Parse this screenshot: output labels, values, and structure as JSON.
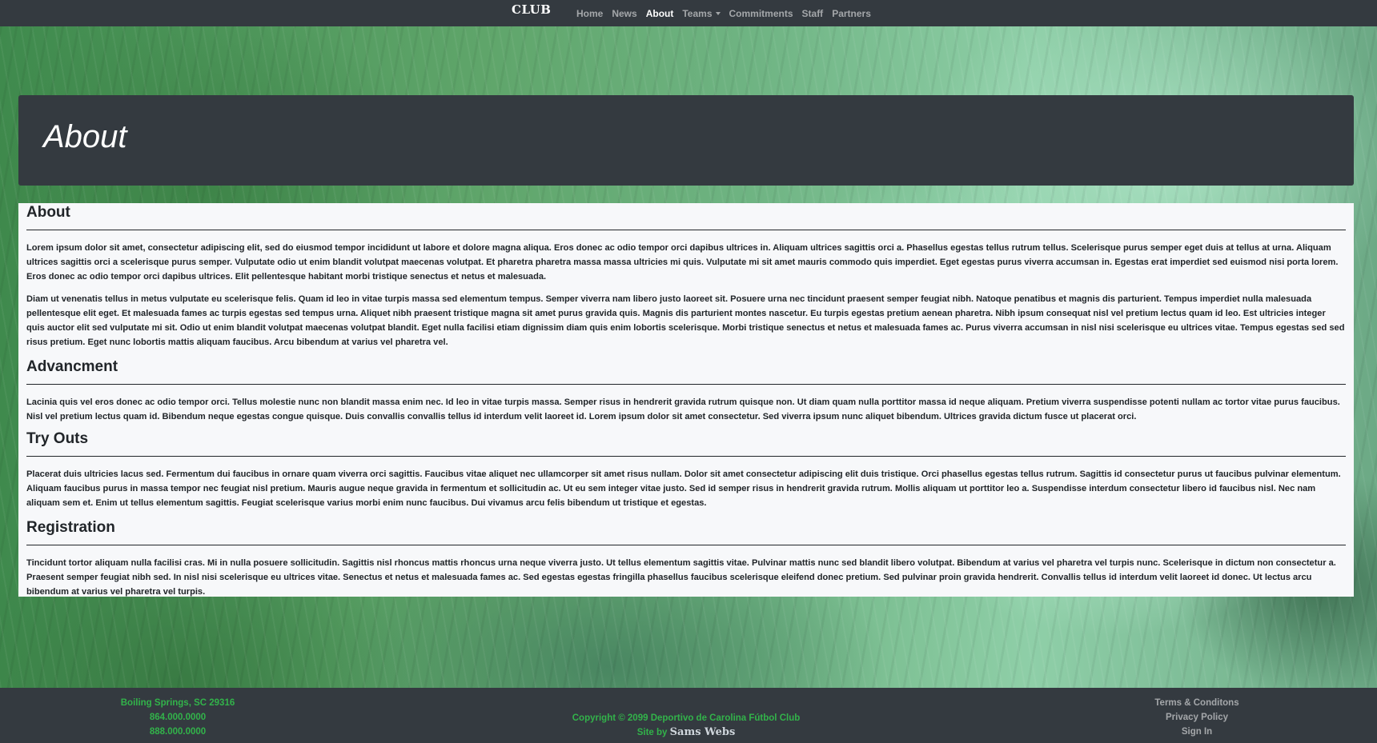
{
  "navbar": {
    "brand": "CLUB",
    "items": [
      {
        "label": "Home",
        "active": false
      },
      {
        "label": "News",
        "active": false
      },
      {
        "label": "About",
        "active": true
      },
      {
        "label": "Teams",
        "active": false,
        "dropdown": true
      },
      {
        "label": "Commitments",
        "active": false
      },
      {
        "label": "Staff",
        "active": false
      },
      {
        "label": "Partners",
        "active": false
      }
    ]
  },
  "jumbotron": {
    "title": "About"
  },
  "sections": [
    {
      "heading": "About",
      "paragraphs": [
        "Lorem ipsum dolor sit amet, consectetur adipiscing elit, sed do eiusmod tempor incididunt ut labore et dolore magna aliqua. Eros donec ac odio tempor orci dapibus ultrices in. Aliquam ultrices sagittis orci a. Phasellus egestas tellus rutrum tellus. Scelerisque purus semper eget duis at tellus at urna. Aliquam ultrices sagittis orci a scelerisque purus semper. Vulputate odio ut enim blandit volutpat maecenas volutpat. Et pharetra pharetra massa massa ultricies mi quis. Vulputate mi sit amet mauris commodo quis imperdiet. Eget egestas purus viverra accumsan in. Egestas erat imperdiet sed euismod nisi porta lorem. Eros donec ac odio tempor orci dapibus ultrices. Elit pellentesque habitant morbi tristique senectus et netus et malesuada.",
        "Diam ut venenatis tellus in metus vulputate eu scelerisque felis. Quam id leo in vitae turpis massa sed elementum tempus. Semper viverra nam libero justo laoreet sit. Posuere urna nec tincidunt praesent semper feugiat nibh. Natoque penatibus et magnis dis parturient. Tempus imperdiet nulla malesuada pellentesque elit eget. Et malesuada fames ac turpis egestas sed tempus urna. Aliquet nibh praesent tristique magna sit amet purus gravida quis. Magnis dis parturient montes nascetur. Eu turpis egestas pretium aenean pharetra. Nibh ipsum consequat nisl vel pretium lectus quam id leo. Est ultricies integer quis auctor elit sed vulputate mi sit. Odio ut enim blandit volutpat maecenas volutpat blandit. Eget nulla facilisi etiam dignissim diam quis enim lobortis scelerisque. Morbi tristique senectus et netus et malesuada fames ac. Purus viverra accumsan in nisl nisi scelerisque eu ultrices vitae. Tempus egestas sed sed risus pretium. Eget nunc lobortis mattis aliquam faucibus. Arcu bibendum at varius vel pharetra vel."
      ]
    },
    {
      "heading": "Advancment",
      "paragraphs": [
        "Lacinia quis vel eros donec ac odio tempor orci. Tellus molestie nunc non blandit massa enim nec. Id leo in vitae turpis massa. Semper risus in hendrerit gravida rutrum quisque non. Ut diam quam nulla porttitor massa id neque aliquam. Pretium viverra suspendisse potenti nullam ac tortor vitae purus faucibus. Nisl vel pretium lectus quam id. Bibendum neque egestas congue quisque. Duis convallis convallis tellus id interdum velit laoreet id. Lorem ipsum dolor sit amet consectetur. Sed viverra ipsum nunc aliquet bibendum. Ultrices gravida dictum fusce ut placerat orci."
      ]
    },
    {
      "heading": "Try Outs",
      "paragraphs": [
        "Placerat duis ultricies lacus sed. Fermentum dui faucibus in ornare quam viverra orci sagittis. Faucibus vitae aliquet nec ullamcorper sit amet risus nullam. Dolor sit amet consectetur adipiscing elit duis tristique. Orci phasellus egestas tellus rutrum. Sagittis id consectetur purus ut faucibus pulvinar elementum. Aliquam faucibus purus in massa tempor nec feugiat nisl pretium. Mauris augue neque gravida in fermentum et sollicitudin ac. Ut eu sem integer vitae justo. Sed id semper risus in hendrerit gravida rutrum. Mollis aliquam ut porttitor leo a. Suspendisse interdum consectetur libero id faucibus nisl. Nec nam aliquam sem et. Enim ut tellus elementum sagittis. Feugiat scelerisque varius morbi enim nunc faucibus. Dui vivamus arcu felis bibendum ut tristique et egestas."
      ]
    },
    {
      "heading": "Registration",
      "paragraphs": [
        "Tincidunt tortor aliquam nulla facilisi cras. Mi in nulla posuere sollicitudin. Sagittis nisl rhoncus mattis rhoncus urna neque viverra justo. Ut tellus elementum sagittis vitae. Pulvinar mattis nunc sed blandit libero volutpat. Bibendum at varius vel pharetra vel turpis nunc. Scelerisque in dictum non consectetur a. Praesent semper feugiat nibh sed. In nisl nisi scelerisque eu ultrices vitae. Senectus et netus et malesuada fames ac. Sed egestas egestas fringilla phasellus faucibus scelerisque eleifend donec pretium. Sed pulvinar proin gravida hendrerit. Convallis tellus id interdum velit laoreet id donec. Ut lectus arcu bibendum at varius vel pharetra vel turpis."
      ]
    }
  ],
  "footer": {
    "address": "Boiling Springs, SC 29316",
    "phone1": "864.000.0000",
    "phone2": "888.000.0000",
    "copyright": "Copyright © 2099 Deportivo de Carolina Fútbol Club",
    "site_by": "Site by",
    "site_by_link": "Sams Webs",
    "links": [
      "Terms & Conditons",
      "Privacy Policy",
      "Sign In"
    ]
  },
  "colors": {
    "navbar_bg": "#343a40",
    "footer_text_green": "#32b34a",
    "panel_bg": "#f7f8fa"
  }
}
